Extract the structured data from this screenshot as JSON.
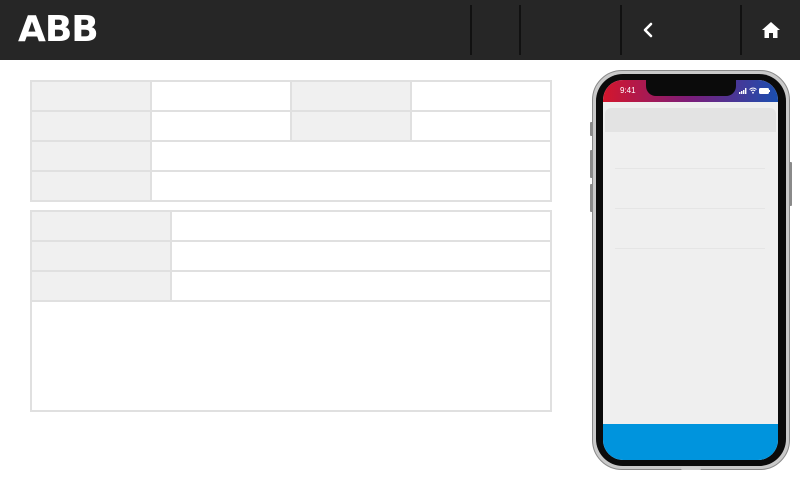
{
  "header": {
    "logo_text": "ABB",
    "back_icon": "chevron-left-icon",
    "home_icon": "home-icon",
    "background_color": "#262626"
  },
  "info_table_1": {
    "rows": [
      {
        "label": "",
        "value": "",
        "label2": "",
        "value2": ""
      },
      {
        "label": "",
        "value": "",
        "label2": "",
        "value2": ""
      },
      {
        "label": "",
        "value": ""
      },
      {
        "label": "",
        "value": ""
      }
    ]
  },
  "info_table_2": {
    "rows": [
      {
        "label": "",
        "value": ""
      },
      {
        "label": "",
        "value": ""
      },
      {
        "label": "",
        "value": ""
      }
    ],
    "notes": ""
  },
  "phone_preview": {
    "status_time": "9:41",
    "accent_color": "#0094dd"
  }
}
